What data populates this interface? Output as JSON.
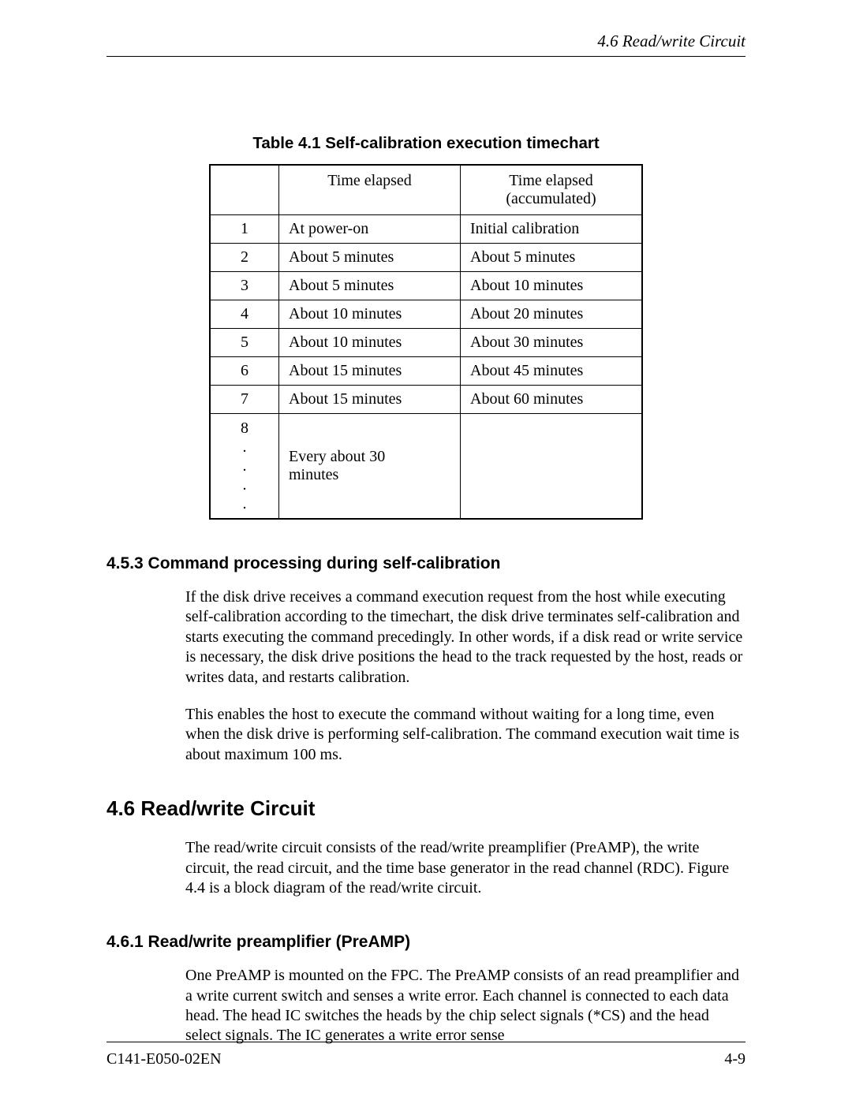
{
  "header": {
    "text": "4.6  Read/write Circuit"
  },
  "table": {
    "caption": "Table 4.1   Self-calibration execution timechart",
    "head": {
      "col1": "Time elapsed",
      "col2_line1": "Time elapsed",
      "col2_line2": "(accumulated)"
    },
    "rows": [
      {
        "n": "1",
        "c1": "At power-on",
        "c2": "Initial calibration"
      },
      {
        "n": "2",
        "c1": "About 5 minutes",
        "c2": "About 5 minutes"
      },
      {
        "n": "3",
        "c1": "About 5 minutes",
        "c2": "About 10 minutes"
      },
      {
        "n": "4",
        "c1": "About 10 minutes",
        "c2": "About 20 minutes"
      },
      {
        "n": "5",
        "c1": "About 10 minutes",
        "c2": "About 30 minutes"
      },
      {
        "n": "6",
        "c1": "About 15 minutes",
        "c2": "About 45 minutes"
      },
      {
        "n": "7",
        "c1": "About 15 minutes",
        "c2": "About 60 minutes"
      }
    ],
    "last": {
      "n_line1": "8",
      "n_dots1": ".",
      "n_dots2": ".",
      "n_dots3": ".",
      "n_dots4": ".",
      "c1_line1": "Every about 30",
      "c1_line2": "minutes"
    }
  },
  "s453": {
    "title": "4.5.3  Command processing during self-calibration",
    "p1": "If the disk drive receives a command execution request from the host while executing self-calibration according to the timechart, the disk drive terminates self-calibration and starts executing the command precedingly.  In other words, if a disk read or write service is necessary, the disk drive positions the head to the track requested by the host, reads or writes data, and restarts calibration.",
    "p2": "This enables the host to execute the command without waiting for a long time, even when the disk drive is performing self-calibration.  The command execution wait time is about maximum 100 ms."
  },
  "s46": {
    "title": "4.6  Read/write Circuit",
    "p1": "The read/write circuit consists of the read/write preamplifier (PreAMP), the write circuit, the read circuit, and the time base generator in the read channel (RDC).  Figure 4.4 is a block diagram of the read/write circuit."
  },
  "s461": {
    "title": "4.6.1  Read/write preamplifier (PreAMP)",
    "p1": "One PreAMP is mounted on the FPC.  The PreAMP consists of an read preamplifier and a write current switch and senses a write error.  Each channel is connected to each data head.  The head IC switches the heads by the chip select signals (*CS) and the head select signals.  The IC generates a write error sense"
  },
  "footer": {
    "left": "C141-E050-02EN",
    "right": "4-9"
  }
}
